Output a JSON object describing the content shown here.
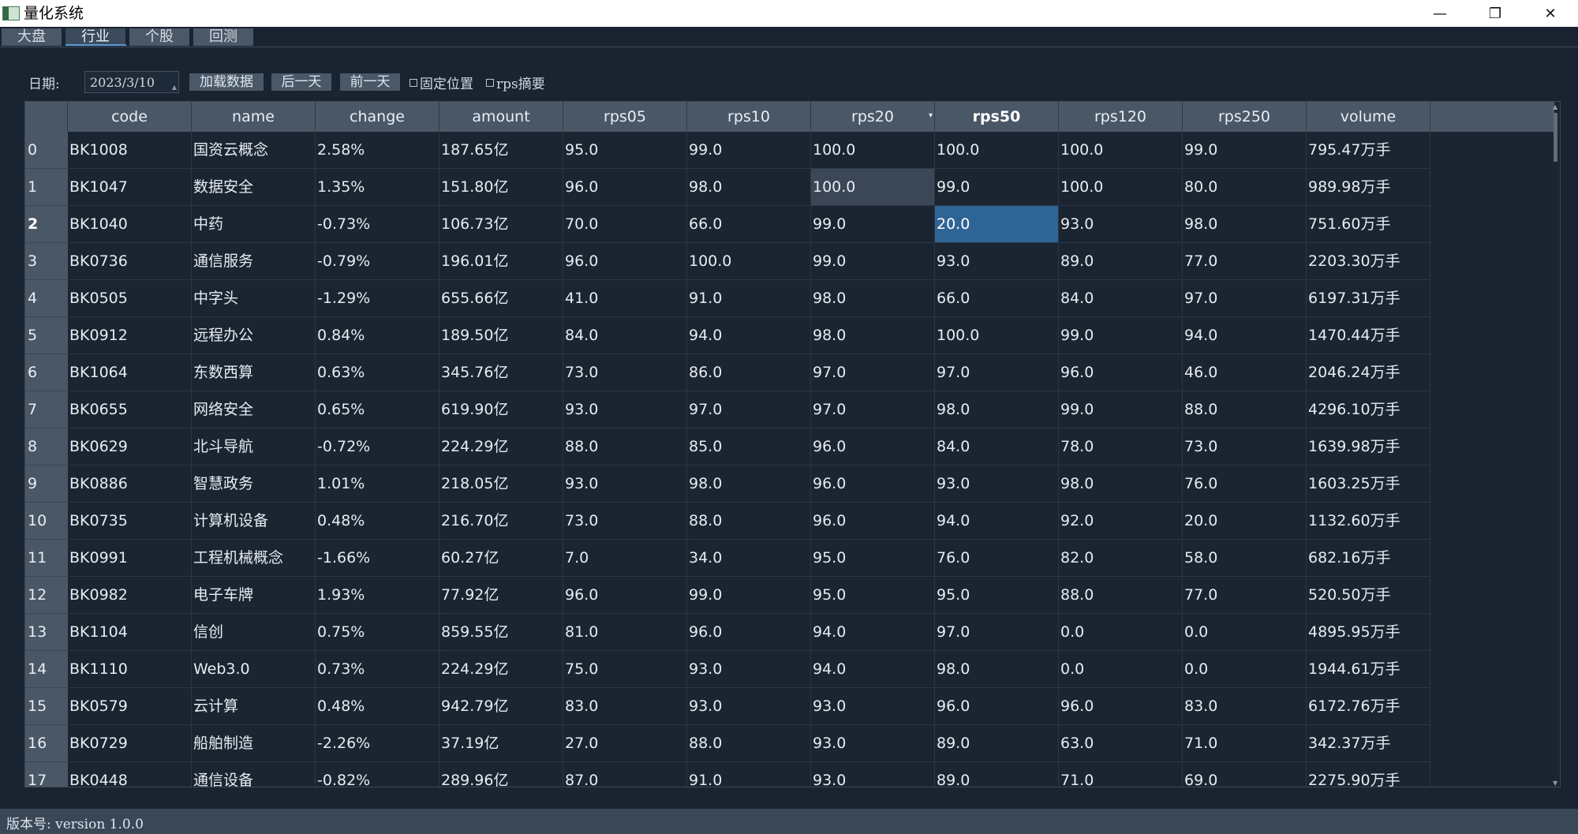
{
  "window": {
    "title": "量化系统",
    "min_icon": "—",
    "max_icon": "❐",
    "close_icon": "✕"
  },
  "tabs": [
    {
      "label": "大盘"
    },
    {
      "label": "行业",
      "active": true
    },
    {
      "label": "个股"
    },
    {
      "label": "回测"
    }
  ],
  "toolbar": {
    "date_label": "日期:",
    "date_value": "2023/3/10",
    "load_button": "加载数据",
    "next_day_button": "后一天",
    "prev_day_button": "前一天",
    "fixed_position_label": "固定位置",
    "rps_summary_label": "rps摘要"
  },
  "table": {
    "columns": [
      "code",
      "name",
      "change",
      "amount",
      "rps05",
      "rps10",
      "rps20",
      "rps50",
      "rps120",
      "rps250",
      "volume"
    ],
    "sorted_column": "rps20",
    "bold_column": "rps50",
    "current_row": 2,
    "rows": [
      [
        "0",
        "BK1008",
        "国资云概念",
        "2.58%",
        "187.65亿",
        "95.0",
        "99.0",
        "100.0",
        "100.0",
        "100.0",
        "99.0",
        "795.47万手"
      ],
      [
        "1",
        "BK1047",
        "数据安全",
        "1.35%",
        "151.80亿",
        "96.0",
        "98.0",
        "100.0",
        "99.0",
        "100.0",
        "80.0",
        "989.98万手"
      ],
      [
        "2",
        "BK1040",
        "中药",
        "-0.73%",
        "106.73亿",
        "70.0",
        "66.0",
        "99.0",
        "20.0",
        "93.0",
        "98.0",
        "751.60万手"
      ],
      [
        "3",
        "BK0736",
        "通信服务",
        "-0.79%",
        "196.01亿",
        "96.0",
        "100.0",
        "99.0",
        "93.0",
        "89.0",
        "77.0",
        "2203.30万手"
      ],
      [
        "4",
        "BK0505",
        "中字头",
        "-1.29%",
        "655.66亿",
        "41.0",
        "91.0",
        "98.0",
        "66.0",
        "84.0",
        "97.0",
        "6197.31万手"
      ],
      [
        "5",
        "BK0912",
        "远程办公",
        "0.84%",
        "189.50亿",
        "84.0",
        "94.0",
        "98.0",
        "100.0",
        "99.0",
        "94.0",
        "1470.44万手"
      ],
      [
        "6",
        "BK1064",
        "东数西算",
        "0.63%",
        "345.76亿",
        "73.0",
        "86.0",
        "97.0",
        "97.0",
        "96.0",
        "46.0",
        "2046.24万手"
      ],
      [
        "7",
        "BK0655",
        "网络安全",
        "0.65%",
        "619.90亿",
        "93.0",
        "97.0",
        "97.0",
        "98.0",
        "99.0",
        "88.0",
        "4296.10万手"
      ],
      [
        "8",
        "BK0629",
        "北斗导航",
        "-0.72%",
        "224.29亿",
        "88.0",
        "85.0",
        "96.0",
        "84.0",
        "78.0",
        "73.0",
        "1639.98万手"
      ],
      [
        "9",
        "BK0886",
        "智慧政务",
        "1.01%",
        "218.05亿",
        "93.0",
        "98.0",
        "96.0",
        "93.0",
        "98.0",
        "76.0",
        "1603.25万手"
      ],
      [
        "10",
        "BK0735",
        "计算机设备",
        "0.48%",
        "216.70亿",
        "73.0",
        "88.0",
        "96.0",
        "94.0",
        "92.0",
        "20.0",
        "1132.60万手"
      ],
      [
        "11",
        "BK0991",
        "工程机械概念",
        "-1.66%",
        "60.27亿",
        "7.0",
        "34.0",
        "95.0",
        "76.0",
        "82.0",
        "58.0",
        "682.16万手"
      ],
      [
        "12",
        "BK0982",
        "电子车牌",
        "1.93%",
        "77.92亿",
        "96.0",
        "99.0",
        "95.0",
        "95.0",
        "88.0",
        "77.0",
        "520.50万手"
      ],
      [
        "13",
        "BK1104",
        "信创",
        "0.75%",
        "859.55亿",
        "81.0",
        "96.0",
        "94.0",
        "97.0",
        "0.0",
        "0.0",
        "4895.95万手"
      ],
      [
        "14",
        "BK1110",
        "Web3.0",
        "0.73%",
        "224.29亿",
        "75.0",
        "93.0",
        "94.0",
        "98.0",
        "0.0",
        "0.0",
        "1944.61万手"
      ],
      [
        "15",
        "BK0579",
        "云计算",
        "0.48%",
        "942.79亿",
        "83.0",
        "93.0",
        "93.0",
        "96.0",
        "96.0",
        "83.0",
        "6172.76万手"
      ],
      [
        "16",
        "BK0729",
        "船舶制造",
        "-2.26%",
        "37.19亿",
        "27.0",
        "88.0",
        "93.0",
        "89.0",
        "63.0",
        "71.0",
        "342.37万手"
      ],
      [
        "17",
        "BK0448",
        "通信设备",
        "-0.82%",
        "289.96亿",
        "87.0",
        "91.0",
        "93.0",
        "89.0",
        "71.0",
        "69.0",
        "2275.90万手"
      ]
    ]
  },
  "statusbar": {
    "text": "版本号: version 1.0.0"
  },
  "colors": {
    "background": "#1a2431",
    "header": "#4a5767",
    "selection": "#2f6496",
    "selection_soft": "#3b4656"
  }
}
